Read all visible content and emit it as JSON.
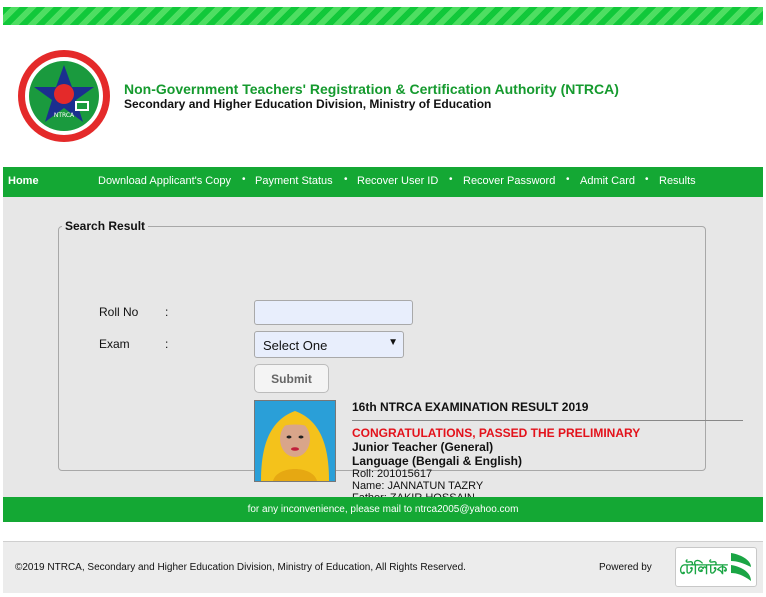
{
  "header": {
    "org_name": "Non-Government Teachers' Registration & Certification Authority (NTRCA)",
    "org_sub": "Secondary and Higher Education Division, Ministry of Education",
    "logo": {
      "center_text": "NTRCA"
    }
  },
  "nav": {
    "items": [
      {
        "label": "Home"
      },
      {
        "label": "Download Applicant's Copy"
      },
      {
        "label": "Payment Status"
      },
      {
        "label": "Recover User ID"
      },
      {
        "label": "Recover Password"
      },
      {
        "label": "Admit Card"
      },
      {
        "label": "Results"
      }
    ],
    "separator": "•"
  },
  "search": {
    "legend": "Search Result",
    "roll_label": "Roll No",
    "exam_label": "Exam",
    "colon": ":",
    "roll_value": "",
    "exam_value": "Select One",
    "submit_label": "Submit"
  },
  "result": {
    "title": "16th NTRCA EXAMINATION RESULT 2019",
    "status": "CONGRATULATIONS, PASSED THE PRELIMINARY",
    "post": "Junior Teacher (General)",
    "subject": "Language (Bengali & English)",
    "roll": "Roll: 201015617",
    "name": "Name: JANNATUN TAZRY",
    "father": "Father: ZAKIR HOSSAIN"
  },
  "contact_text": "for any inconvenience, please mail to ntrca2005@yahoo.com",
  "footer": {
    "copyright": "©2019 NTRCA, Secondary and Higher Education Division, Ministry of Education, All Rights Reserved.",
    "powered_by": "Powered by",
    "partner_logo_text": "টেলিটক"
  },
  "colors": {
    "brand_green": "#14a834",
    "title_green": "#159a2e",
    "alert_red": "#e3121b"
  }
}
